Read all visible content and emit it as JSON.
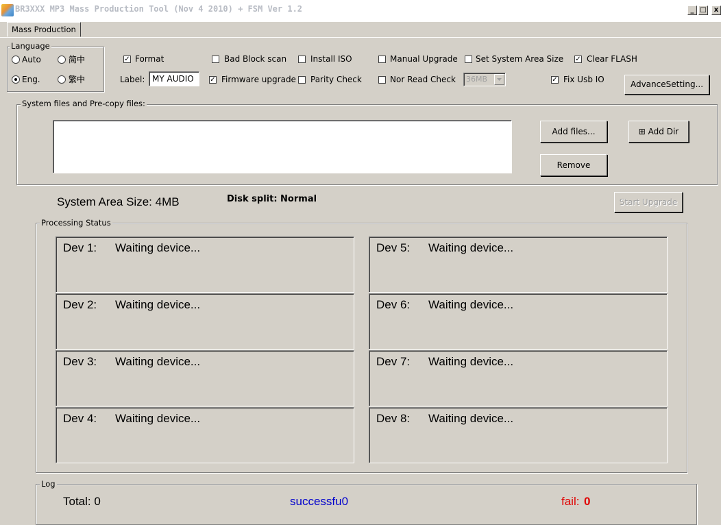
{
  "window": {
    "title": "BR3XXX MP3 Mass Production Tool (Nov  4 2010) + FSM Ver 1.2",
    "minimize": "_",
    "maximize": "□",
    "close": "x"
  },
  "tabs": [
    {
      "label": "Mass Production",
      "active": true
    }
  ],
  "language": {
    "group_label": "Language",
    "options": [
      {
        "label": "Auto",
        "selected": false
      },
      {
        "label": "简中",
        "selected": false
      },
      {
        "label": "Eng.",
        "selected": true
      },
      {
        "label": "繁中",
        "selected": false
      }
    ]
  },
  "options": {
    "format": {
      "label": "Format",
      "checked": true
    },
    "bad_block_scan": {
      "label": "Bad Block scan",
      "checked": false
    },
    "install_iso": {
      "label": "Install ISO",
      "checked": false
    },
    "manual_upgrade": {
      "label": "Manual Upgrade",
      "checked": false
    },
    "set_system_area_size": {
      "label": "Set System Area Size",
      "checked": false
    },
    "clear_flash": {
      "label": "Clear FLASH",
      "checked": true
    },
    "label_caption": "Label:",
    "label_value": "MY AUDIO",
    "firmware_upgrade": {
      "label": "Firmware upgrade",
      "checked": true
    },
    "parity_check": {
      "label": "Parity Check",
      "checked": false
    },
    "nor_read_check": {
      "label": "Nor Read Check",
      "checked": false
    },
    "size_select": "36MB",
    "fix_usb_io": {
      "label": "Fix Usb IO",
      "checked": true
    },
    "advance_setting": "AdvanceSetting..."
  },
  "system_files": {
    "group_label": "System files and Pre-copy files:",
    "add_files": "Add files...",
    "add_dir": "Add Dir",
    "remove": "Remove"
  },
  "status_line": {
    "system_area": "System Area Size: 4MB",
    "disk_split": "Disk split:  Normal",
    "start_upgrade": "Start Upgrade"
  },
  "processing": {
    "group_label": "Processing Status",
    "devices": [
      {
        "name": "Dev 1:",
        "status": "Waiting device..."
      },
      {
        "name": "Dev 2:",
        "status": "Waiting device..."
      },
      {
        "name": "Dev 3:",
        "status": "Waiting device..."
      },
      {
        "name": "Dev 4:",
        "status": "Waiting device..."
      },
      {
        "name": "Dev 5:",
        "status": "Waiting device..."
      },
      {
        "name": "Dev 6:",
        "status": "Waiting device..."
      },
      {
        "name": "Dev 7:",
        "status": "Waiting device..."
      },
      {
        "name": "Dev 8:",
        "status": "Waiting device..."
      }
    ]
  },
  "log": {
    "group_label": "Log",
    "total": "Total:  0",
    "success": "successfu0",
    "fail_label": "fail:",
    "fail_value": "0",
    "colors": {
      "success": "#0000cc",
      "fail": "#e00000"
    }
  }
}
